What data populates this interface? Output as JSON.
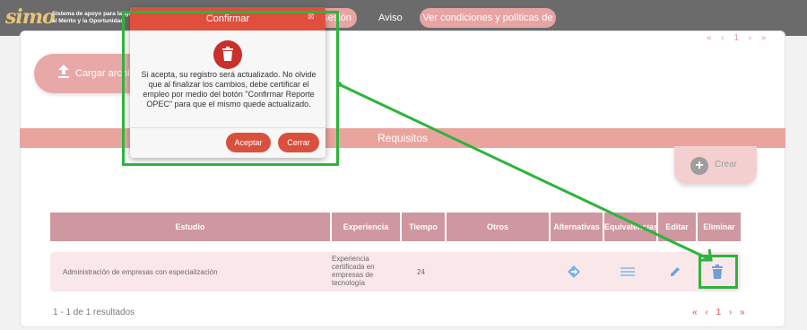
{
  "header": {
    "logo_mark": "simo",
    "logo_line1": "Sistema de apoyo para la Igualdad,",
    "logo_line2": "al Mérito y la Oportunidad",
    "session_label": "sesión",
    "notice_label": "Aviso",
    "terms_label": "Ver condiciones y políticas de uso"
  },
  "upload": {
    "label": "Cargar archivo"
  },
  "requirements": {
    "title": "Requisitos",
    "create_label": "Crear",
    "columns": [
      "Estudio",
      "Experiencia",
      "Tiempo",
      "Otros",
      "Alternativas",
      "Equivalencias",
      "Editar",
      "Eliminar"
    ],
    "rows": [
      {
        "study": "Administración de empresas con especialización",
        "experience": "Experiencia certificada en empresas de tecnología",
        "time": "24"
      }
    ],
    "results_text": "1 - 1 de 1 resultados",
    "pager": {
      "first": "«",
      "prev": "‹",
      "page": "1",
      "next": "›",
      "last": "»"
    },
    "pager_top": "« ‹ 1 › »"
  },
  "modal": {
    "title": "Confirmar",
    "close_glyph": "⊠",
    "message": "Si acepta, su registro será actualizado. No olvide que al finalizar los cambios, debe certificar el empleo por medio del botón \"Confirmar Reporte OPEC\" para que el mismo quede actualizado.",
    "accept_label": "Aceptar",
    "cancel_label": "Cerrar"
  },
  "colors": {
    "accent": "#e04e3c",
    "header_row": "#cf97a0",
    "annotation": "#2db43c",
    "action_blue": "#5b9bd5"
  }
}
